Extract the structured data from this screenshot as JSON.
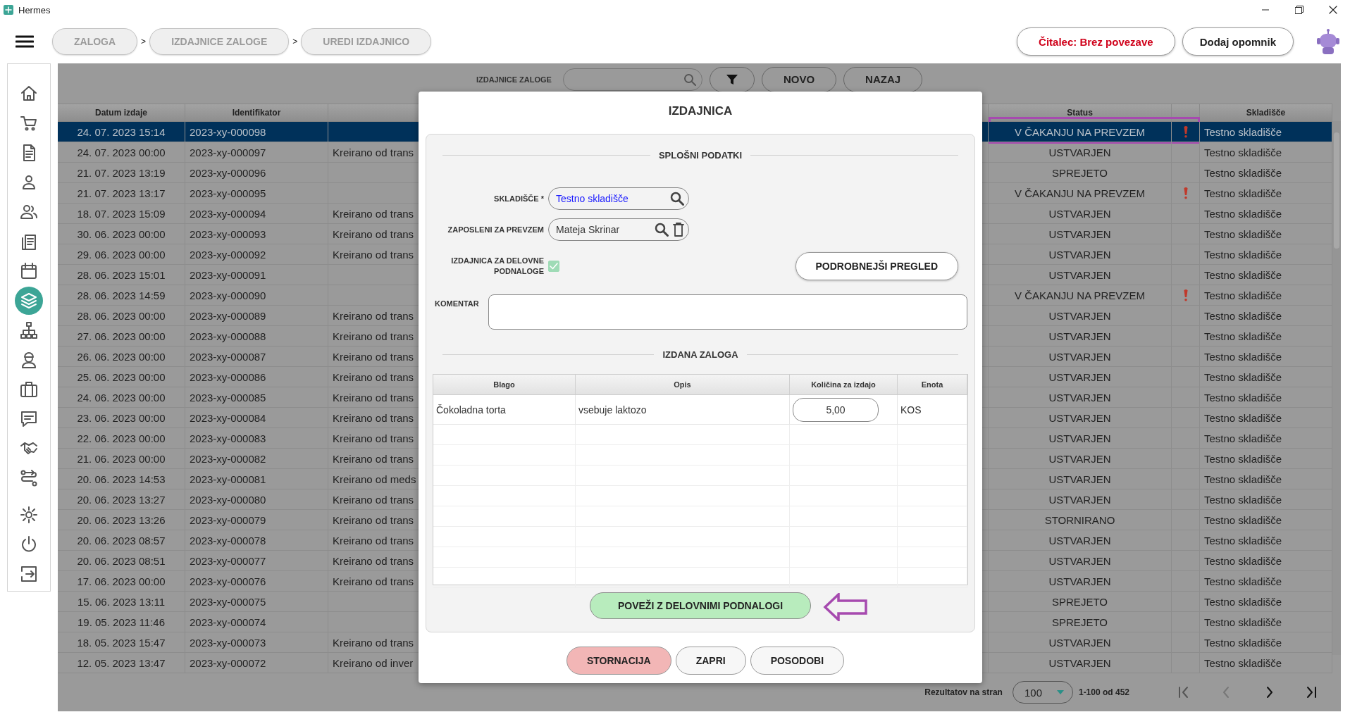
{
  "window": {
    "title": "Hermes"
  },
  "breadcrumbs": [
    {
      "label": "ZALOGA",
      "separator": ">"
    },
    {
      "label": "IZDAJNICE ZALOGE",
      "separator": ">"
    },
    {
      "label": "UREDI IZDAJNICO"
    }
  ],
  "header_buttons": [
    {
      "label": "Čitalec: Brez povezave",
      "kind": "alert"
    },
    {
      "label": "Dodaj opomnik",
      "kind": "plain"
    }
  ],
  "sidebar": {
    "items": [
      {
        "kind": "home",
        "selected": false,
        "gap_before": false
      },
      {
        "kind": "cart",
        "selected": false,
        "gap_before": false
      },
      {
        "kind": "document",
        "selected": false,
        "gap_before": false
      },
      {
        "kind": "person",
        "selected": false,
        "gap_before": false
      },
      {
        "kind": "people",
        "selected": false,
        "gap_before": false
      },
      {
        "kind": "documents",
        "selected": false,
        "gap_before": false
      },
      {
        "kind": "calendar",
        "selected": false,
        "gap_before": false
      },
      {
        "kind": "layers",
        "selected": true,
        "gap_before": false
      },
      {
        "kind": "sitemap",
        "selected": false,
        "gap_before": false
      },
      {
        "kind": "worker",
        "selected": false,
        "gap_before": false
      },
      {
        "kind": "briefcase",
        "selected": false,
        "gap_before": false
      },
      {
        "kind": "chat",
        "selected": false,
        "gap_before": false
      },
      {
        "kind": "handshake",
        "selected": false,
        "gap_before": false
      },
      {
        "kind": "route",
        "selected": false,
        "gap_before": false
      },
      {
        "kind": "gear",
        "selected": false,
        "gap_before": true
      },
      {
        "kind": "power",
        "selected": false,
        "gap_before": false
      },
      {
        "kind": "logout",
        "selected": false,
        "gap_before": false
      }
    ]
  },
  "toolbar": {
    "label": "IZDAJNICE ZALOGE",
    "buttons": [
      {
        "kind": "filter"
      },
      {
        "kind": "text",
        "label": "NOVO"
      },
      {
        "kind": "text",
        "label": "NAZAJ"
      }
    ]
  },
  "table": {
    "columns": [
      "Datum izdaje",
      "Identifikator",
      null,
      "Status",
      null,
      "Skladišče"
    ],
    "rows": [
      {
        "cells": [
          "24. 07. 2023 15:14",
          "2023-xy-000098",
          null,
          "V ČAKANJU NA PREVZEM",
          "Testno skladišče"
        ],
        "alert": true,
        "selected": true,
        "highlighted": true
      },
      {
        "cells": [
          "24. 07. 2023 00:00",
          "2023-xy-000097",
          "Kreirano od trans",
          "USTVARJEN",
          "Testno skladišče"
        ],
        "alert": false,
        "selected": false,
        "highlighted": false
      },
      {
        "cells": [
          "21. 07. 2023 13:19",
          "2023-xy-000096",
          null,
          "SPREJETO",
          "Testno skladišče"
        ],
        "alert": false,
        "selected": false,
        "highlighted": false
      },
      {
        "cells": [
          "21. 07. 2023 13:17",
          "2023-xy-000095",
          null,
          "V ČAKANJU NA PREVZEM",
          "Testno skladišče"
        ],
        "alert": true,
        "selected": false,
        "highlighted": false
      },
      {
        "cells": [
          "18. 07. 2023 15:09",
          "2023-xy-000094",
          "Kreirano od trans",
          "USTVARJEN",
          "Testno skladišče"
        ],
        "alert": false,
        "selected": false,
        "highlighted": false
      },
      {
        "cells": [
          "30. 06. 2023 00:00",
          "2023-xy-000093",
          "Kreirano od trans",
          "USTVARJEN",
          "Testno skladišče"
        ],
        "alert": false,
        "selected": false,
        "highlighted": false
      },
      {
        "cells": [
          "29. 06. 2023 00:00",
          "2023-xy-000092",
          "Kreirano od trans",
          "USTVARJEN",
          "Testno skladišče"
        ],
        "alert": false,
        "selected": false,
        "highlighted": false
      },
      {
        "cells": [
          "28. 06. 2023 15:01",
          "2023-xy-000091",
          null,
          "USTVARJEN",
          "Testno skladišče"
        ],
        "alert": false,
        "selected": false,
        "highlighted": false
      },
      {
        "cells": [
          "28. 06. 2023 14:59",
          "2023-xy-000090",
          null,
          "V ČAKANJU NA PREVZEM",
          "Testno skladišče"
        ],
        "alert": true,
        "selected": false,
        "highlighted": false
      },
      {
        "cells": [
          "28. 06. 2023 00:00",
          "2023-xy-000089",
          "Kreirano od trans",
          "USTVARJEN",
          "Testno skladišče"
        ],
        "alert": false,
        "selected": false,
        "highlighted": false
      },
      {
        "cells": [
          "27. 06. 2023 00:00",
          "2023-xy-000088",
          "Kreirano od trans",
          "USTVARJEN",
          "Testno skladišče"
        ],
        "alert": false,
        "selected": false,
        "highlighted": false
      },
      {
        "cells": [
          "26. 06. 2023 00:00",
          "2023-xy-000087",
          "Kreirano od trans",
          "USTVARJEN",
          "Testno skladišče"
        ],
        "alert": false,
        "selected": false,
        "highlighted": false
      },
      {
        "cells": [
          "25. 06. 2023 00:00",
          "2023-xy-000086",
          "Kreirano od trans",
          "USTVARJEN",
          "Testno skladišče"
        ],
        "alert": false,
        "selected": false,
        "highlighted": false
      },
      {
        "cells": [
          "24. 06. 2023 00:00",
          "2023-xy-000085",
          "Kreirano od trans",
          "USTVARJEN",
          "Testno skladišče"
        ],
        "alert": false,
        "selected": false,
        "highlighted": false
      },
      {
        "cells": [
          "23. 06. 2023 00:00",
          "2023-xy-000084",
          "Kreirano od trans",
          "USTVARJEN",
          "Testno skladišče"
        ],
        "alert": false,
        "selected": false,
        "highlighted": false
      },
      {
        "cells": [
          "22. 06. 2023 00:00",
          "2023-xy-000083",
          "Kreirano od trans",
          "USTVARJEN",
          "Testno skladišče"
        ],
        "alert": false,
        "selected": false,
        "highlighted": false
      },
      {
        "cells": [
          "21. 06. 2023 00:00",
          "2023-xy-000082",
          "Kreirano od trans",
          "USTVARJEN",
          "Testno skladišče"
        ],
        "alert": false,
        "selected": false,
        "highlighted": false
      },
      {
        "cells": [
          "20. 06. 2023 14:53",
          "2023-xy-000081",
          "Kreirano od meds",
          "USTVARJEN",
          "Testno skladišče"
        ],
        "alert": false,
        "selected": false,
        "highlighted": false
      },
      {
        "cells": [
          "20. 06. 2023 13:27",
          "2023-xy-000080",
          "Kreirano od trans",
          "USTVARJEN",
          "Testno skladišče"
        ],
        "alert": false,
        "selected": false,
        "highlighted": false
      },
      {
        "cells": [
          "20. 06. 2023 13:26",
          "2023-xy-000079",
          "Kreirano od trans",
          "STORNIRANO",
          "Testno skladišče"
        ],
        "alert": false,
        "selected": false,
        "highlighted": false
      },
      {
        "cells": [
          "20. 06. 2023 08:57",
          "2023-xy-000078",
          "Kreirano od trans",
          "USTVARJEN",
          "Testno skladišče"
        ],
        "alert": false,
        "selected": false,
        "highlighted": false
      },
      {
        "cells": [
          "20. 06. 2023 08:51",
          "2023-xy-000077",
          "Kreirano od trans",
          "USTVARJEN",
          "Testno skladišče"
        ],
        "alert": false,
        "selected": false,
        "highlighted": false
      },
      {
        "cells": [
          "17. 06. 2023 00:00",
          "2023-xy-000076",
          "Kreirano od trans",
          "USTVARJEN",
          "Testno skladišče"
        ],
        "alert": false,
        "selected": false,
        "highlighted": false
      },
      {
        "cells": [
          "15. 06. 2023 13:11",
          "2023-xy-000075",
          null,
          "SPREJETO",
          "Testno skladišče"
        ],
        "alert": false,
        "selected": false,
        "highlighted": false
      },
      {
        "cells": [
          "19. 05. 2023 11:46",
          "2023-xy-000074",
          null,
          "SPREJETO",
          "Testno skladišče"
        ],
        "alert": false,
        "selected": false,
        "highlighted": false
      },
      {
        "cells": [
          "18. 05. 2023 15:47",
          "2023-xy-000073",
          "Kreirano od trans",
          "USTVARJEN",
          "Testno skladišče"
        ],
        "alert": false,
        "selected": false,
        "highlighted": false
      },
      {
        "cells": [
          "12. 05. 2023 13:47",
          "2023-xy-000072",
          "Kreirano od inver",
          "USTVARJEN",
          "Testno skladišče"
        ],
        "alert": false,
        "selected": false,
        "highlighted": false
      }
    ]
  },
  "pagination": {
    "label": "Rezultatov na stran",
    "page_size": "100",
    "range": "1-100 od 452"
  },
  "dialog": {
    "title": "IZDAJNICA",
    "general_heading": "SPLOŠNI PODATKI",
    "fields": [
      {
        "label": "SKLADIŠČE *",
        "value": "Testno skladišče",
        "kind": "lookup"
      },
      {
        "label": "ZAPOSLENI ZA PREVZEM",
        "value": "Mateja Skrinar",
        "kind": "lookup_clearable"
      }
    ],
    "checkbox": {
      "label": "IZDAJNICA ZA DELOVNE PODNALOGE",
      "checked": true
    },
    "details_button": "PODROBNEJŠI PREGLED",
    "comment": {
      "label": "KOMENTAR"
    },
    "items_heading": "IZDANA ZALOGA",
    "items_table": {
      "columns": [
        "Blago",
        "Opis",
        "Količina za izdajo",
        "Enota"
      ],
      "rows": [
        {
          "item": "Čokoladna torta",
          "description": "vsebuje laktozo",
          "quantity": "5,00",
          "unit": "KOS"
        }
      ]
    },
    "link_button": {
      "label": "POVEŽI Z DELOVNIMI PODNALOGI",
      "pointed_at": true
    },
    "actions": [
      {
        "label": "STORNACIJA",
        "kind": "danger"
      },
      {
        "label": "ZAPRI",
        "kind": "plain"
      },
      {
        "label": "POSODOBI",
        "kind": "plain"
      }
    ]
  }
}
